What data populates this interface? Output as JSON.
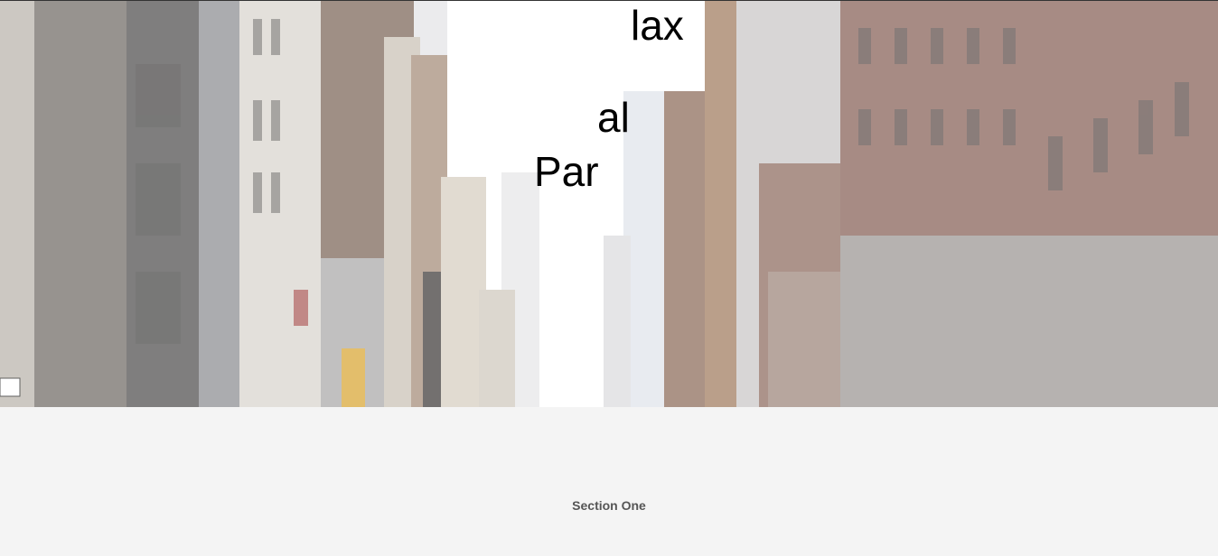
{
  "hero": {
    "background": "city-street-photo",
    "words": {
      "lax": "lax",
      "al": "al",
      "par": "Par"
    }
  },
  "section_one": {
    "title": "Section One"
  },
  "colors": {
    "section_bg": "#f4f4f4",
    "section_text": "#555555",
    "hero_text": "#000000"
  }
}
